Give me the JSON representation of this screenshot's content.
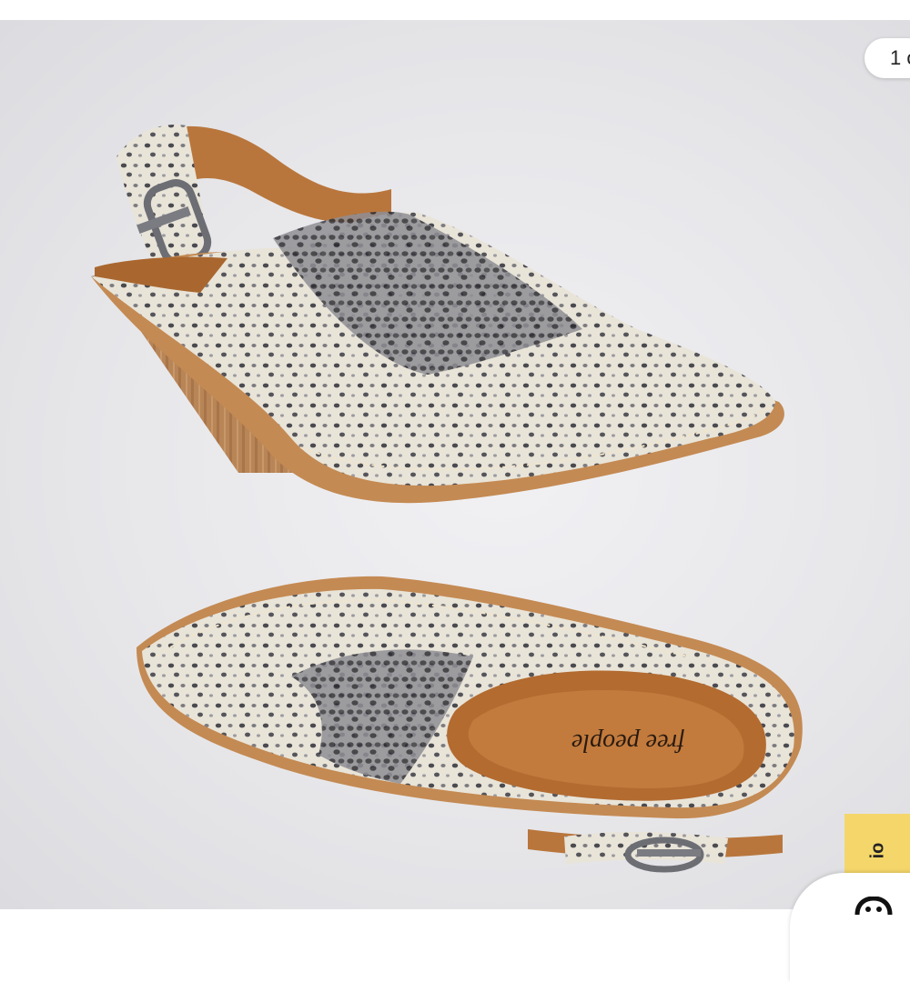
{
  "photo": {
    "alt_subject": "",
    "insole_brand": "free people"
  },
  "counter": {
    "text": "1 o"
  },
  "badge": {
    "text": "io"
  },
  "fab": {
    "icon": "bag-icon"
  },
  "colors": {
    "background": "#e7e7ea",
    "snakeskin_base": "#e9e4d8",
    "snakeskin_spot": "#3f3f45",
    "leather_tan": "#b9763c",
    "sole": "#c48a53",
    "heel_wood": "#b88557",
    "badge_yellow": "#f4d66a"
  }
}
